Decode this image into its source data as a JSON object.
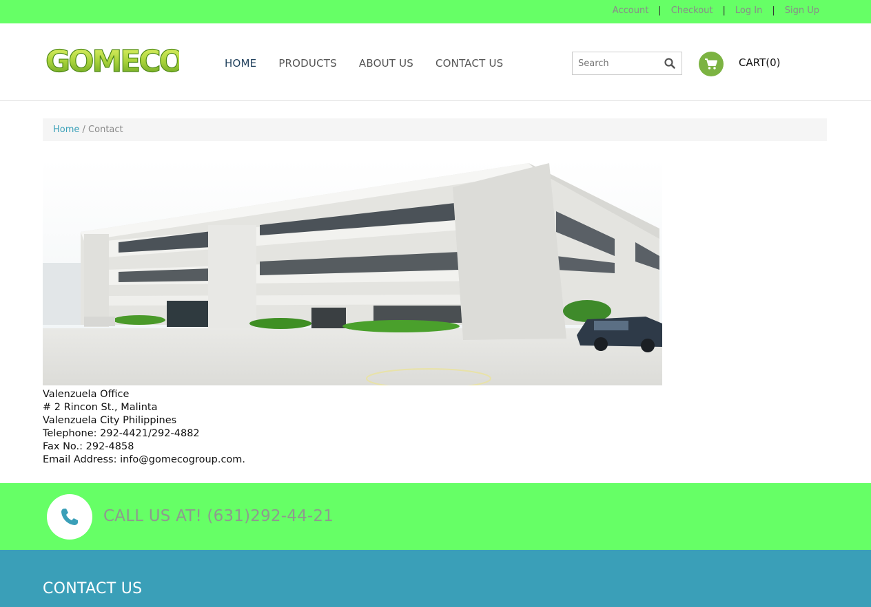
{
  "topbar": {
    "links": [
      "Account",
      "Checkout",
      "Log In",
      "Sign Up"
    ],
    "bg_color": "#66ff66"
  },
  "header": {
    "logo_text": "GOMECO",
    "nav": [
      "HOME",
      "PRODUCTS",
      "ABOUT US",
      "CONTACT US"
    ],
    "search_placeholder": "Search",
    "cart_label": "CART(0)",
    "cart_icon": "cart-icon",
    "search_icon": "search-icon"
  },
  "breadcrumb": {
    "home": "Home",
    "separator": " / ",
    "current": "Contact"
  },
  "office": {
    "name": "Valenzuela Office",
    "street": "# 2 Rincon St., Malinta",
    "city": "Valenzuela City Philippines",
    "telephone": "Telephone: 292-4421/292-4882",
    "fax": "Fax No.: 292-4858",
    "email": "Email Address: info@gomecogroup.com."
  },
  "callbar": {
    "text": "CALL US AT! (631)292-44-21",
    "icon": "phone-icon"
  },
  "footer": {
    "title": "CONTACT US",
    "bg_color": "#3a9fb8"
  }
}
